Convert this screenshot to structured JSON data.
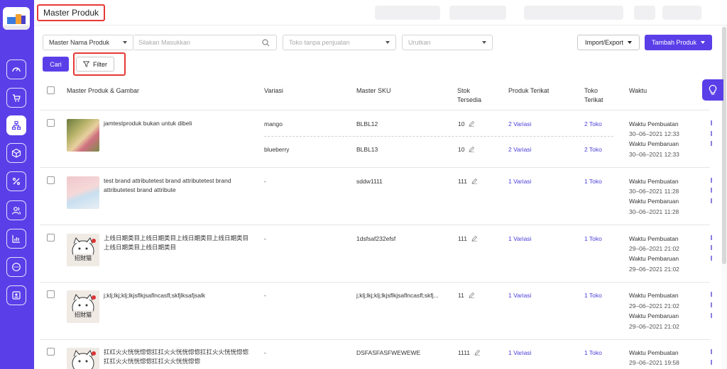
{
  "header": {
    "title": "Master Produk"
  },
  "filters": {
    "field_select": "Master Nama Produk",
    "search_placeholder": "Silakan Masukkan",
    "store_placeholder": "Toko tanpa penjualan",
    "sort_placeholder": "Urutkan",
    "search_button": "Cari",
    "filter_button": "Filter",
    "import_export_button": "Import/Export",
    "add_product_button": "Tambah Produk"
  },
  "table": {
    "headers": {
      "product": "Master Produk & Gambar",
      "variant": "Variasi",
      "sku": "Master SKU",
      "stock_l1": "Stok",
      "stock_l2": "Tersedia",
      "linked": "Produk Terikat",
      "store_l1": "Toko",
      "store_l2": "Terikat",
      "time": "Waktu"
    },
    "rows": [
      {
        "name": "jamtestproduk bukan untuk dibeli",
        "variants": [
          {
            "variant": "mango",
            "sku": "BLBL12",
            "stock": "10",
            "linked": "2 Variasi",
            "stores": "2 Toko",
            "created_label": "Waktu Pembuatan",
            "created": "30–06–2021 12:33",
            "updated_label": "Waktu Pembaruan",
            "updated": "30–06–2021 12:33"
          },
          {
            "variant": "blueberry",
            "sku": "BLBL13",
            "stock": "10",
            "linked": "2 Variasi",
            "stores": "2 Toko"
          }
        ]
      },
      {
        "name": "test brand attributetest brand attributetest brand attributetest brand attribute",
        "variant": "-",
        "sku": "sddw1111",
        "stock": "111",
        "linked": "1 Variasi",
        "stores": "1 Toko",
        "created_label": "Waktu Pembuatan",
        "created": "30–06–2021 11:28",
        "updated_label": "Waktu Pembaruan",
        "updated": "30–06–2021 11:28"
      },
      {
        "name": "上线日期类目上线日期类目上线日期类目上线日期类目上线日期类目上线日期类目",
        "variant": "-",
        "sku": "1dsfsaf232efsf",
        "stock": "111",
        "linked": "1 Variasi",
        "stores": "1 Toko",
        "created_label": "Waktu Pembuatan",
        "created": "29–06–2021 21:02",
        "updated_label": "Waktu Pembaruan",
        "updated": "29–06–2021 21:02"
      },
      {
        "name": "j;klj;lkj;klj;lkjsflkjsaflncasfl;skfjlksafjsalk",
        "variant": "-",
        "sku": "j;klj;lkj;klj;lkjsflkjsaflncasfl;skfj...",
        "stock": "11",
        "linked": "1 Variasi",
        "stores": "1 Toko",
        "created_label": "Waktu Pembuatan",
        "created": "29–06–2021 21:02",
        "updated_label": "Waktu Pembaruan",
        "updated": "29–06–2021 21:02"
      },
      {
        "name": "扛红火火恍恍惚惚扛扛火火恍恍惚惚扛扛火火恍恍惚惚扛扛火火恍恍惚惚扛扛火火恍恍惚惚",
        "variant": "-",
        "sku": "DSFASFASFWEWEWE",
        "stock": "1111",
        "linked": "1 Variasi",
        "stores": "1 Toko",
        "created_label": "Waktu Pembuatan",
        "created": "29–06–2021 19:58"
      }
    ]
  },
  "colors": {
    "accent": "#5a3fe8",
    "highlight": "#e53935",
    "link": "#4a3fd8"
  },
  "icons": [
    "dashboard-icon",
    "cart-icon",
    "hierarchy-icon",
    "box-icon",
    "percent-icon",
    "users-icon",
    "chart-icon",
    "chat-icon",
    "add-box-icon",
    "search-icon",
    "filter-icon",
    "edit-icon",
    "lightbulb-icon"
  ]
}
